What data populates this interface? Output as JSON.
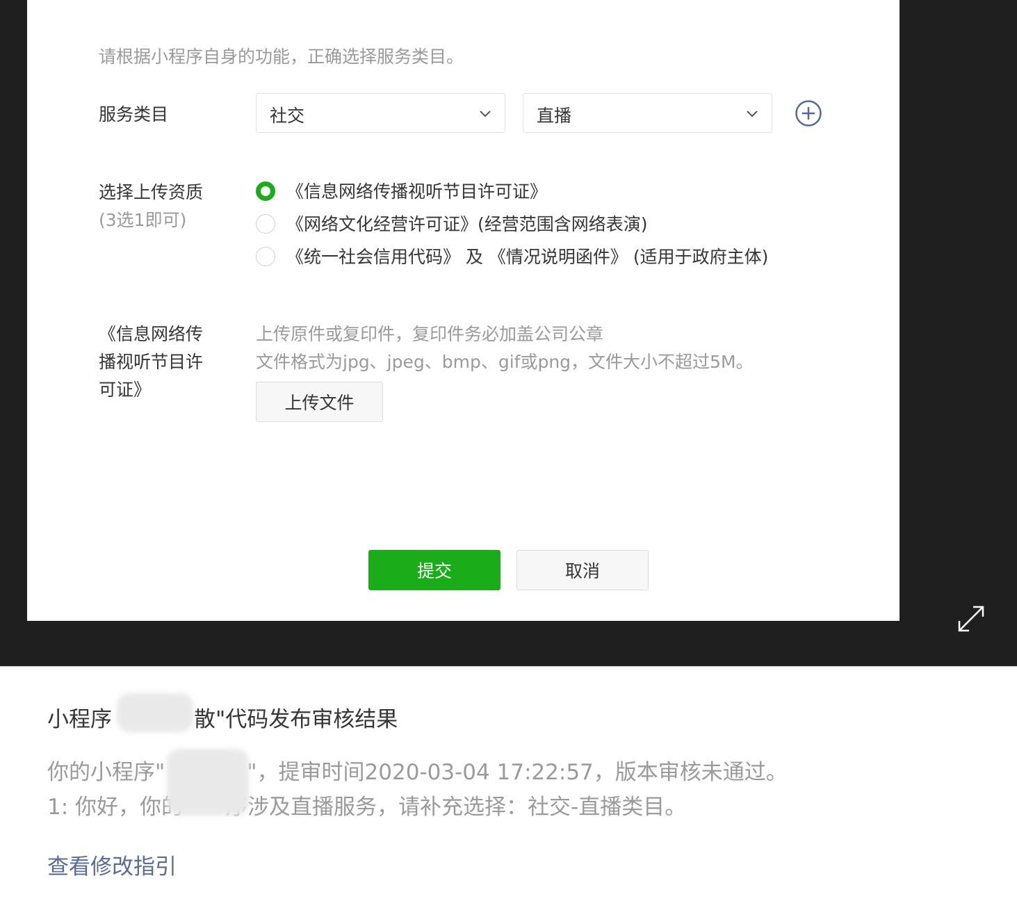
{
  "form": {
    "hint": "请根据小程序自身的功能，正确选择服务类目。",
    "category_label": "服务类目",
    "category_primary": "社交",
    "category_secondary": "直播",
    "qualification_label": "选择上传资质",
    "qualification_sublabel": "(3选1即可)",
    "options": [
      {
        "text": "《信息网络传播视听节目许可证》",
        "checked": true
      },
      {
        "text": "《网络文化经营许可证》(经营范围含网络表演)",
        "checked": false
      },
      {
        "text": "《统一社会信用代码》 及 《情况说明函件》 (适用于政府主体)",
        "checked": false
      }
    ],
    "upload_label_lines": [
      "《信息网络传",
      "播视听节目许",
      "可证》"
    ],
    "upload_hint_1": "上传原件或复印件，复印件务必加盖公司公章",
    "upload_hint_2": "文件格式为jpg、jpeg、bmp、gif或png，文件大小不超过5M。",
    "upload_button": "上传文件",
    "submit_button": "提交",
    "cancel_button": "取消"
  },
  "message": {
    "title_prefix": "小程序",
    "title_suffix": "散\"代码发布审核结果",
    "line1_prefix": "你的小程序\"",
    "line1_suffix": "\"，提审时间2020-03-04 17:22:57，版本审核未通过。",
    "line2_prefix": "1: 你好，你的",
    "line2_suffix": "序涉及直播服务，请补充选择：社交-直播类目。",
    "link": "查看修改指引"
  },
  "colors": {
    "accent_green": "#1aad19",
    "link_blue": "#576b95",
    "icon_blue": "#4e6aa0",
    "dark_bg": "#1f1f1f"
  },
  "icons": [
    "chevron-down-icon",
    "add-circle-icon",
    "expand-icon"
  ]
}
